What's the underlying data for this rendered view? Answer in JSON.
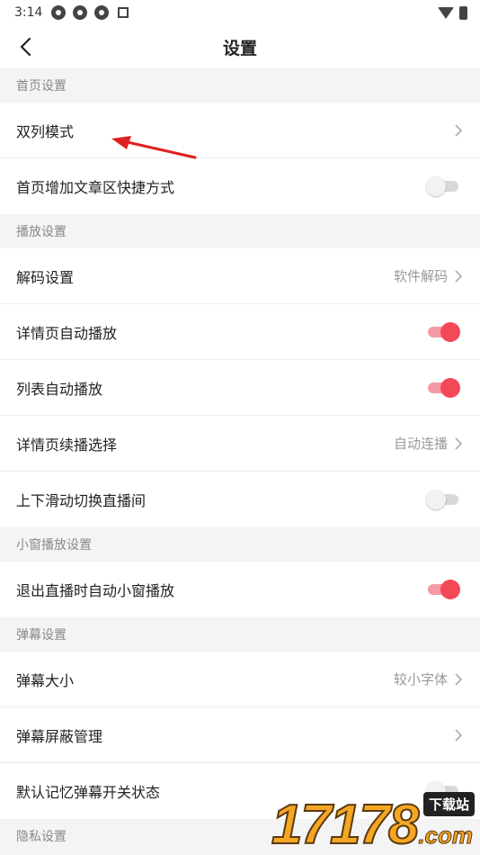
{
  "statusbar": {
    "time": "3:14"
  },
  "header": {
    "title": "设置"
  },
  "sections": {
    "home": "首页设置",
    "play": "播放设置",
    "mini": "小窗播放设置",
    "danmaku": "弹幕设置",
    "privacy": "隐私设置"
  },
  "rows": {
    "double_column": {
      "label": "双列模式"
    },
    "shortcut": {
      "label": "首页增加文章区快捷方式",
      "on": false
    },
    "decode": {
      "label": "解码设置",
      "value": "软件解码"
    },
    "detail_autoplay": {
      "label": "详情页自动播放",
      "on": true
    },
    "list_autoplay": {
      "label": "列表自动播放",
      "on": true
    },
    "continue_play": {
      "label": "详情页续播选择",
      "value": "自动连播"
    },
    "swipe_live": {
      "label": "上下滑动切换直播间",
      "on": false
    },
    "exit_live_mini": {
      "label": "退出直播时自动小窗播放",
      "on": true
    },
    "danmaku_size": {
      "label": "弹幕大小",
      "value": "较小字体"
    },
    "danmaku_block": {
      "label": "弹幕屏蔽管理"
    },
    "danmaku_remember": {
      "label": "默认记忆弹幕开关状态",
      "on": false
    }
  },
  "watermark": {
    "digits": "17178",
    "tag": "下载站",
    "com": ".com"
  },
  "colors": {
    "accent": "#f24857",
    "accent_track": "#f59aa4",
    "section_bg": "#f4f4f4",
    "annotation_arrow": "#e02020"
  }
}
